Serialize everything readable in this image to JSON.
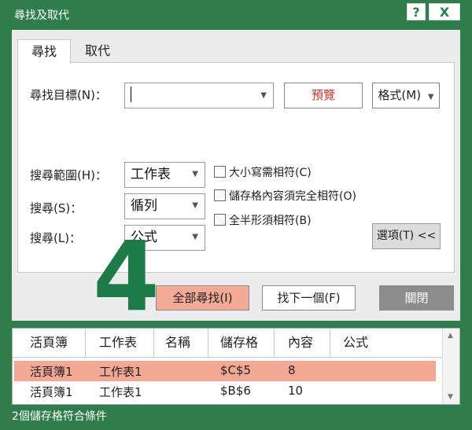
{
  "window": {
    "title": "尋找及取代",
    "help_label": "?",
    "close_label": "X"
  },
  "tabs": [
    {
      "label": "尋找"
    },
    {
      "label": "取代"
    }
  ],
  "find": {
    "label": "尋找目標(N)：",
    "value": "",
    "preview_label": "預覽",
    "format_label": "格式(M)"
  },
  "options": {
    "within_label": "搜尋範圍(H)：",
    "within_value": "工作表",
    "search_label": "搜尋(S)：",
    "search_value": "循列",
    "lookin_label": "搜尋(L)：",
    "lookin_value": "公式",
    "match_case": "大小寫需相符(C)",
    "match_entire": "儲存格內容須完全相符(O)",
    "match_byte": "全半形須相符(B)",
    "options_button": "選項(T) <<"
  },
  "buttons": {
    "find_all": "全部尋找(I)",
    "find_next": "找下一個(F)",
    "close": "關閉"
  },
  "annotation": {
    "step_number": "4",
    "color": "#1e7a48"
  },
  "results": {
    "headers": [
      "活頁簿",
      "工作表",
      "名稱",
      "儲存格",
      "內容",
      "公式"
    ],
    "rows": [
      {
        "book": "活頁簿1",
        "sheet": "工作表1",
        "name": "",
        "cell": "$C$5",
        "value": "8",
        "formula": "",
        "selected": true
      },
      {
        "book": "活頁簿1",
        "sheet": "工作表1",
        "name": "",
        "cell": "$B$6",
        "value": "10",
        "formula": "",
        "selected": false
      }
    ]
  },
  "status": "2個儲存格符合條件",
  "colors": {
    "frame": "#2e7d4a",
    "find_all_bg": "#f2a996",
    "selected_row": "#f3a795",
    "preview_text": "#c0392b",
    "close_btn": "#8c8c8c"
  }
}
